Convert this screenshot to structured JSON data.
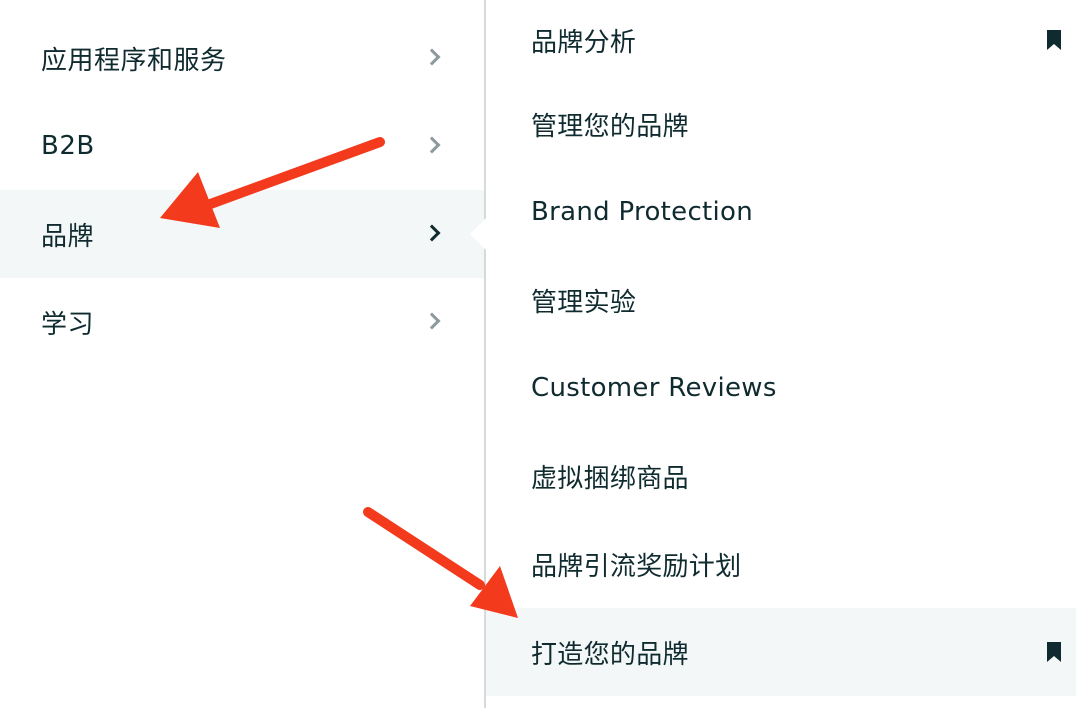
{
  "left_menu": {
    "items": [
      {
        "label": "应用程序和服务"
      },
      {
        "label": "B2B"
      },
      {
        "label": "品牌"
      },
      {
        "label": "学习"
      }
    ]
  },
  "right_menu": {
    "items": [
      {
        "label": "品牌分析"
      },
      {
        "label": "管理您的品牌"
      },
      {
        "label": "Brand Protection"
      },
      {
        "label": "管理实验"
      },
      {
        "label": "Customer Reviews"
      },
      {
        "label": "虚拟捆绑商品"
      },
      {
        "label": "品牌引流奖励计划"
      },
      {
        "label": "打造您的品牌"
      }
    ]
  },
  "colors": {
    "text": "#0f2b2f",
    "active_background": "#f4f7f7",
    "annotation_arrow": "#f33a1d"
  }
}
